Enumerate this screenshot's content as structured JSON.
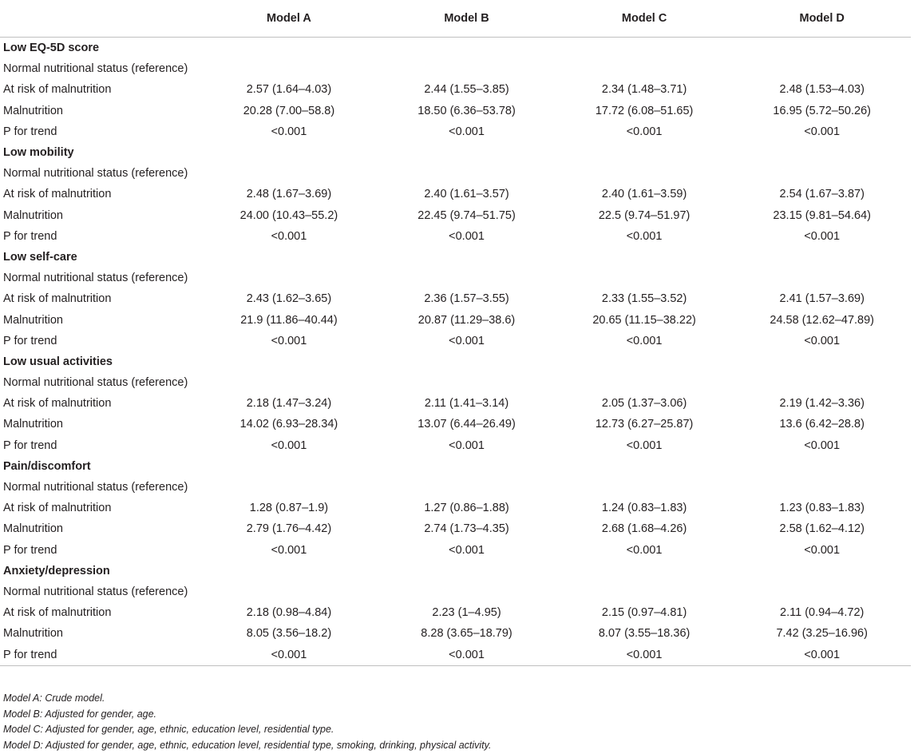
{
  "table": {
    "columns": [
      "",
      "Model A",
      "Model B",
      "Model C",
      "Model D"
    ],
    "sections": [
      {
        "title": "Low EQ-5D score",
        "rows": [
          {
            "label": "Normal nutritional status (reference)",
            "values": [
              "",
              "",
              "",
              ""
            ]
          },
          {
            "label": "At risk of malnutrition",
            "values": [
              "2.57 (1.64–4.03)",
              "2.44 (1.55–3.85)",
              "2.34 (1.48–3.71)",
              "2.48 (1.53–4.03)"
            ]
          },
          {
            "label": "Malnutrition",
            "values": [
              "20.28 (7.00–58.8)",
              "18.50 (6.36–53.78)",
              "17.72 (6.08–51.65)",
              "16.95 (5.72–50.26)"
            ]
          },
          {
            "label": "P for trend",
            "values": [
              "<0.001",
              "<0.001",
              "<0.001",
              "<0.001"
            ]
          }
        ]
      },
      {
        "title": "Low mobility",
        "rows": [
          {
            "label": "Normal nutritional status (reference)",
            "values": [
              "",
              "",
              "",
              ""
            ]
          },
          {
            "label": "At risk of malnutrition",
            "values": [
              "2.48 (1.67–3.69)",
              "2.40 (1.61–3.57)",
              "2.40 (1.61–3.59)",
              "2.54 (1.67–3.87)"
            ]
          },
          {
            "label": "Malnutrition",
            "values": [
              "24.00 (10.43–55.2)",
              "22.45 (9.74–51.75)",
              "22.5 (9.74–51.97)",
              "23.15 (9.81–54.64)"
            ]
          },
          {
            "label": "P for trend",
            "values": [
              "<0.001",
              "<0.001",
              "<0.001",
              "<0.001"
            ]
          }
        ]
      },
      {
        "title": "Low self-care",
        "rows": [
          {
            "label": "Normal nutritional status (reference)",
            "values": [
              "",
              "",
              "",
              ""
            ]
          },
          {
            "label": "At risk of malnutrition",
            "values": [
              "2.43 (1.62–3.65)",
              "2.36 (1.57–3.55)",
              "2.33 (1.55–3.52)",
              "2.41 (1.57–3.69)"
            ]
          },
          {
            "label": "Malnutrition",
            "values": [
              "21.9 (11.86–40.44)",
              "20.87 (11.29–38.6)",
              "20.65 (11.15–38.22)",
              "24.58 (12.62–47.89)"
            ]
          },
          {
            "label": "P for trend",
            "values": [
              "<0.001",
              "<0.001",
              "<0.001",
              "<0.001"
            ]
          }
        ]
      },
      {
        "title": "Low usual activities",
        "rows": [
          {
            "label": "Normal nutritional status (reference)",
            "values": [
              "",
              "",
              "",
              ""
            ]
          },
          {
            "label": "At risk of malnutrition",
            "values": [
              "2.18 (1.47–3.24)",
              "2.11 (1.41–3.14)",
              "2.05 (1.37–3.06)",
              "2.19 (1.42–3.36)"
            ]
          },
          {
            "label": "Malnutrition",
            "values": [
              "14.02 (6.93–28.34)",
              "13.07 (6.44–26.49)",
              "12.73 (6.27–25.87)",
              "13.6 (6.42–28.8)"
            ]
          },
          {
            "label": "P for trend",
            "values": [
              "<0.001",
              "<0.001",
              "<0.001",
              "<0.001"
            ]
          }
        ]
      },
      {
        "title": "Pain/discomfort",
        "rows": [
          {
            "label": "Normal nutritional status (reference)",
            "values": [
              "",
              "",
              "",
              ""
            ]
          },
          {
            "label": "At risk of malnutrition",
            "values": [
              "1.28 (0.87–1.9)",
              "1.27 (0.86–1.88)",
              "1.24 (0.83–1.83)",
              "1.23 (0.83–1.83)"
            ]
          },
          {
            "label": "Malnutrition",
            "values": [
              "2.79 (1.76–4.42)",
              "2.74 (1.73–4.35)",
              "2.68 (1.68–4.26)",
              "2.58 (1.62–4.12)"
            ]
          },
          {
            "label": "P for trend",
            "values": [
              "<0.001",
              "<0.001",
              "<0.001",
              "<0.001"
            ]
          }
        ]
      },
      {
        "title": "Anxiety/depression",
        "rows": [
          {
            "label": "Normal nutritional status (reference)",
            "values": [
              "",
              "",
              "",
              ""
            ]
          },
          {
            "label": "At risk of malnutrition",
            "values": [
              "2.18 (0.98–4.84)",
              "2.23 (1–4.95)",
              "2.15 (0.97–4.81)",
              "2.11 (0.94–4.72)"
            ]
          },
          {
            "label": "Malnutrition",
            "values": [
              "8.05 (3.56–18.2)",
              "8.28 (3.65–18.79)",
              "8.07 (3.55–18.36)",
              "7.42 (3.25–16.96)"
            ]
          },
          {
            "label": "P for trend",
            "values": [
              "<0.001",
              "<0.001",
              "<0.001",
              "<0.001"
            ]
          }
        ]
      }
    ]
  },
  "footnotes": [
    "Model A: Crude model.",
    "Model B: Adjusted for gender, age.",
    "Model C: Adjusted for gender, age, ethnic, education level, residential type.",
    "Model D: Adjusted for gender, age, ethnic, education level, residential type, smoking, drinking, physical activity."
  ]
}
